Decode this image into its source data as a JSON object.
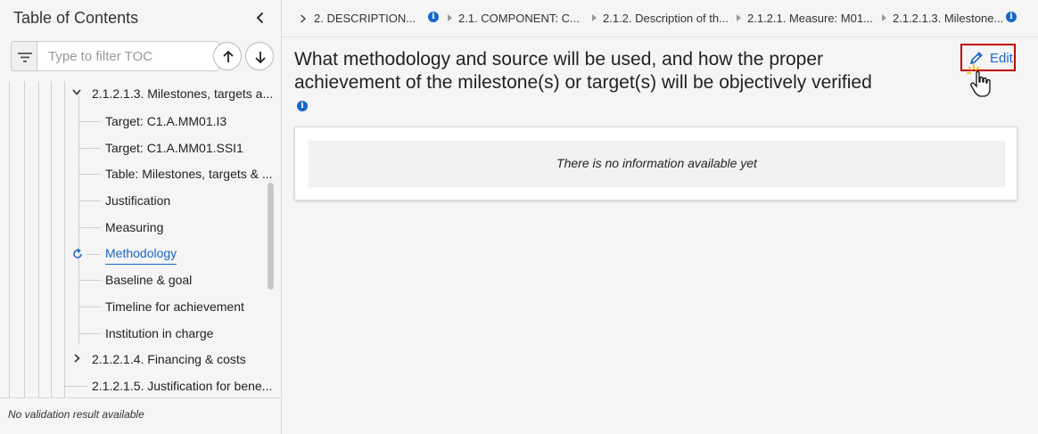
{
  "toc": {
    "title": "Table of Contents",
    "filter_placeholder": "Type to filter TOC",
    "items": [
      {
        "label": "2.1.2.1.3. Milestones, targets a...",
        "icon": "chevron-down-icon"
      },
      {
        "label": "Target: C1.A.MM01.I3"
      },
      {
        "label": "Target: C1.A.MM01.SSI1"
      },
      {
        "label": "Table: Milestones, targets & ..."
      },
      {
        "label": "Justification"
      },
      {
        "label": "Measuring"
      },
      {
        "label": "Methodology",
        "active": true,
        "icon": "refresh-icon"
      },
      {
        "label": "Baseline & goal"
      },
      {
        "label": "Timeline for achievement"
      },
      {
        "label": "Institution in charge"
      },
      {
        "label": "2.1.2.1.4. Financing & costs",
        "icon": "chevron-right-icon"
      },
      {
        "label": "2.1.2.1.5. Justification for bene..."
      }
    ],
    "validation_text": "No validation result available"
  },
  "breadcrumb": [
    {
      "label": "2. DESCRIPTION..."
    },
    {
      "label": "2.1. COMPONENT: C..."
    },
    {
      "label": "2.1.2. Description of th..."
    },
    {
      "label": "2.1.2.1. Measure: M01..."
    },
    {
      "label": "2.1.2.1.3. Milestone..."
    }
  ],
  "main": {
    "title_line1": "What methodology and source will be used, and how the proper",
    "title_line2": "achievement of the milestone(s) or target(s) will be objectively verified",
    "edit_label": "Edit",
    "empty_text": "There is no information available yet"
  },
  "colors": {
    "accent": "#1a66c9",
    "highlight_border": "#c00000",
    "background": "#f5f5f5"
  }
}
